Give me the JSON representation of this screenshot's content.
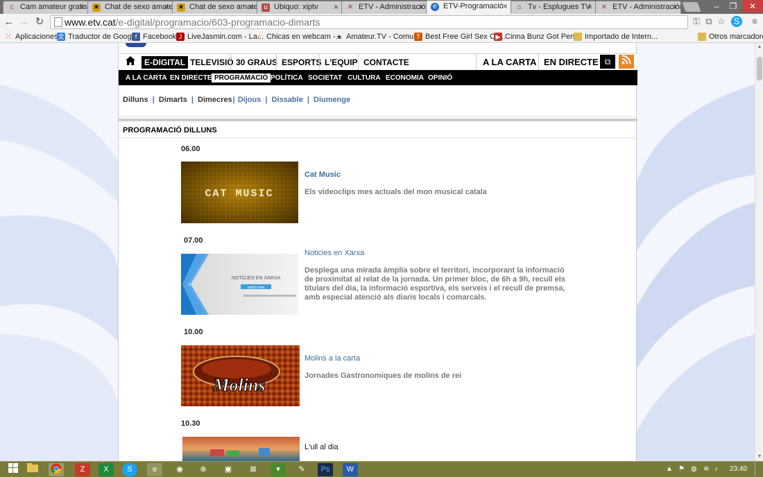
{
  "browser": {
    "tabs": [
      {
        "title": "Cam amateur gratis",
        "icon": "cams-icon",
        "active": false
      },
      {
        "title": "Chat de sexo amateur",
        "icon": "star-icon",
        "active": false
      },
      {
        "title": "Chat de sexo amateur",
        "icon": "star-icon",
        "active": false
      },
      {
        "title": "Ubiquo: xiptv",
        "icon": "ubiquo-icon",
        "active": false
      },
      {
        "title": "ETV - Administración",
        "icon": "admin-icon",
        "active": false
      },
      {
        "title": "ETV-Programació",
        "icon": "etv-icon",
        "active": true
      },
      {
        "title": "Tv - Esplugues TV",
        "icon": "tv-icon",
        "active": false
      },
      {
        "title": "ETV - Administración",
        "icon": "admin-icon",
        "active": false
      }
    ],
    "url_host": "www.etv.cat",
    "url_path": "/e-digital/programacio/603-programacio-dimarts",
    "bookmarks": [
      {
        "label": "Aplicaciones",
        "color": "#c0392b"
      },
      {
        "label": "Traductor de Google",
        "color": "#3b7dd8"
      },
      {
        "label": "Facebook",
        "color": "#3b5998"
      },
      {
        "label": "LiveJasmin.com - La...",
        "color": "#b00000"
      },
      {
        "label": "Chicas en webcam -...",
        "color": "#e67e22"
      },
      {
        "label": "Amateur.TV - Comu...",
        "color": "#222222"
      },
      {
        "label": "Best Free Girl Sex Ca...",
        "color": "#d35400"
      },
      {
        "label": "Cinna Bunz Got Pen...",
        "color": "#c0392b"
      },
      {
        "label": "Importado de Intern...",
        "color": "#d4a017"
      }
    ],
    "other_bookmarks": "Otros marcadores"
  },
  "site": {
    "main_nav": [
      {
        "label": "E-DIGITAL",
        "selected": true
      },
      {
        "label": "TELEVISIÓ",
        "selected": false
      },
      {
        "label": "30 GRAUS",
        "selected": false
      },
      {
        "label": "ESPORTS",
        "selected": false
      },
      {
        "label": "L'EQUIP",
        "selected": false
      },
      {
        "label": "CONTACTE",
        "selected": false
      }
    ],
    "main_nav_right": [
      {
        "label": "A LA CARTA"
      },
      {
        "label": "EN DIRECTE"
      }
    ],
    "sub_nav": [
      {
        "label": "A LA CARTA",
        "selected": false
      },
      {
        "label": "EN DIRECTE",
        "selected": false
      },
      {
        "label": "PROGRAMACIÓ",
        "selected": true
      },
      {
        "label": "POLÍTICA",
        "selected": false
      },
      {
        "label": "SOCIETAT",
        "selected": false
      },
      {
        "label": "CULTURA",
        "selected": false
      },
      {
        "label": "ECONOMIA",
        "selected": false
      },
      {
        "label": "OPINIÓ",
        "selected": false
      }
    ],
    "days": [
      {
        "label": "Dilluns",
        "link": false,
        "after": " | "
      },
      {
        "label": "Dimarts",
        "link": false,
        "after": " | "
      },
      {
        "label": "Dimecres",
        "link": false,
        "after": "| "
      },
      {
        "label": "Dijous",
        "link": true,
        "after": " | "
      },
      {
        "label": "Dissable",
        "link": true,
        "after": " | "
      },
      {
        "label": "Diumenge",
        "link": true,
        "after": ""
      }
    ],
    "section_title": "PROGRAMACIÓ DILLUNS",
    "programs": [
      {
        "time": "06.00",
        "title": "Cat Music",
        "title_bold": true,
        "description": "Els videoclips mes actuals del mon musical catala",
        "thumb_text": "CAT MUSIC"
      },
      {
        "time": "07.00",
        "title": "Noticies en Xarxa",
        "title_bold": false,
        "description": "Desplega una mirada àmplia sobre el territori, incorporant la informació de proximitat al relat de la jornada. Un primer bloc, de 6h a 9h, recull els titulars del dia, la informació esportiva, els serveis i el recull de premsa, amb especial atenció als diaris locals i comarcals.",
        "thumb_text": "NOTÍCIES EN XARXA",
        "thumb_sub": "edició matí"
      },
      {
        "time": "10.00",
        "title": "Molins a la carta",
        "title_bold": false,
        "description": "Jornades Gastronomiques de molins de rei",
        "thumb_text": "Molins"
      },
      {
        "time": "10.30",
        "title": "L'ull al dia",
        "title_bold": false,
        "description": "",
        "thumb_text": ""
      }
    ]
  },
  "taskbar": {
    "clock": "23:40"
  },
  "colors": {
    "link_blue": "#3b6d99",
    "nav_black": "#000000",
    "taskbar": "#7a7a3a"
  }
}
